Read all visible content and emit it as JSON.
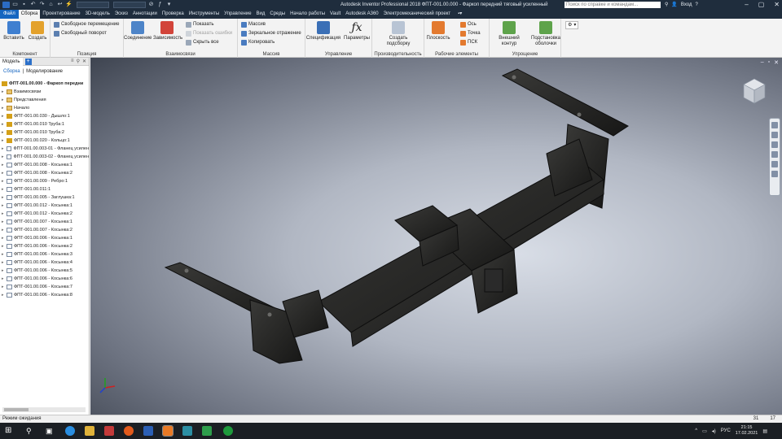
{
  "titlebar": {
    "title": "Autodesk Inventor Professional 2018   ФПТ-001.00.000 - Фаркоп передний тяговый усиленный",
    "search_placeholder": "Поиск по справке и командам...",
    "signin": "Вход"
  },
  "tabs": [
    "Файл",
    "Сборка",
    "Проектирование",
    "3D-модель",
    "Эскиз",
    "Аннотации",
    "Проверка",
    "Инструменты",
    "Управление",
    "Вид",
    "Среды",
    "Начало работы",
    "Vault",
    "Autodesk A360",
    "Электромеханический проект"
  ],
  "ribbon": {
    "component": {
      "label": "Компонент",
      "insert": "Вставить",
      "create": "Создать"
    },
    "position": {
      "label": "Позиция",
      "free_move": "Свободное перемещение",
      "free_rotate": "Свободный поворот"
    },
    "relations": {
      "label": "Взаимосвязи",
      "joint": "Соединение",
      "constrain": "Зависимость",
      "show": "Показать",
      "show_sick": "Показать ошибки",
      "hide_all": "Скрыть все"
    },
    "pattern": {
      "label": "Массив",
      "pattern": "Массив",
      "mirror": "Зеркальное отражение",
      "copy": "Копировать"
    },
    "manage": {
      "label": "Управление",
      "bom": "Спецификация",
      "params": "Параметры"
    },
    "productivity": {
      "label": "Производительность",
      "create_sub": "Создать подсборку"
    },
    "work": {
      "label": "Рабочие элементы",
      "plane": "Плоскость",
      "axis": "Ось",
      "point": "Точка",
      "ucs": "ПСК"
    },
    "simplify": {
      "label": "Упрощение",
      "shrinkwrap": "Внешний контур",
      "envelopes": "Подстановка оболочки"
    }
  },
  "browser": {
    "tab_model": "Модель",
    "mode_assembly": "Сборка",
    "mode_modeling": "Моделирование",
    "root": "ФПТ-001.00.000 - Фаркоп передни",
    "items": [
      {
        "label": "Взаимосвязи",
        "type": "fold"
      },
      {
        "label": "Представления",
        "type": "fold"
      },
      {
        "label": "Начало",
        "type": "fold"
      },
      {
        "label": "ФПТ-001.00.030 - Дышло:1",
        "type": "asm"
      },
      {
        "label": "ФПТ-001.00.010 Труба:1",
        "type": "asm"
      },
      {
        "label": "ФПТ-001.00.010 Труба:2",
        "type": "asm"
      },
      {
        "label": "ФПТ-001.00.020 - Кольцо:1",
        "type": "asm"
      },
      {
        "label": "ФПТ-001.00.003-01 - Фланец усилен",
        "type": "cc"
      },
      {
        "label": "ФПТ-001.00.003-02 - Фланец усилен",
        "type": "cc"
      },
      {
        "label": "ФПТ-001.00.008 - Косынка:1",
        "type": "cc"
      },
      {
        "label": "ФПТ-001.00.008 - Косынка:2",
        "type": "cc"
      },
      {
        "label": "ФПТ-001.00.009 - Ребро:1",
        "type": "cc"
      },
      {
        "label": "ФПТ-001.00.011:1",
        "type": "cc"
      },
      {
        "label": "ФПТ-001.00.005 - Заглушка:1",
        "type": "cc"
      },
      {
        "label": "ФПТ-001.00.012 - Косынка:1",
        "type": "cc"
      },
      {
        "label": "ФПТ-001.00.012 - Косынка:2",
        "type": "cc"
      },
      {
        "label": "ФПТ-001.00.007 - Косынка:1",
        "type": "cc"
      },
      {
        "label": "ФПТ-001.00.007 - Косынка:2",
        "type": "cc"
      },
      {
        "label": "ФПТ-001.00.006 - Косынка:1",
        "type": "cc"
      },
      {
        "label": "ФПТ-001.00.006 - Косынка:2",
        "type": "cc"
      },
      {
        "label": "ФПТ-001.00.006 - Косынка:3",
        "type": "cc"
      },
      {
        "label": "ФПТ-001.00.006 - Косынка:4",
        "type": "cc"
      },
      {
        "label": "ФПТ-001.00.006 - Косынка:5",
        "type": "cc"
      },
      {
        "label": "ФПТ-001.00.006 - Косынка:6",
        "type": "cc"
      },
      {
        "label": "ФПТ-001.00.006 - Косынка:7",
        "type": "cc"
      },
      {
        "label": "ФПТ-001.00.006 - Косынка:8",
        "type": "cc"
      }
    ]
  },
  "status": {
    "text": "Режим ожидания",
    "n1": "31",
    "n2": "17"
  },
  "taskbar": {
    "lang": "РУС",
    "time": "21:15",
    "date": "17.02.2021"
  }
}
